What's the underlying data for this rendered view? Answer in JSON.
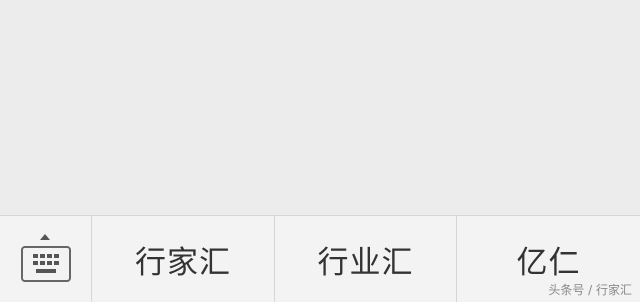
{
  "keyboard_toggle": {
    "icon": "keyboard-icon",
    "indicator_icon": "caret-up-icon"
  },
  "candidates": [
    {
      "label": "行家汇"
    },
    {
      "label": "行业汇"
    },
    {
      "label": "亿仁"
    }
  ],
  "watermark": "头条号 / 行家汇",
  "colors": {
    "background": "#ececec",
    "bar_background": "#f3f3f3",
    "divider": "#d6d6d6",
    "text": "#333333"
  }
}
